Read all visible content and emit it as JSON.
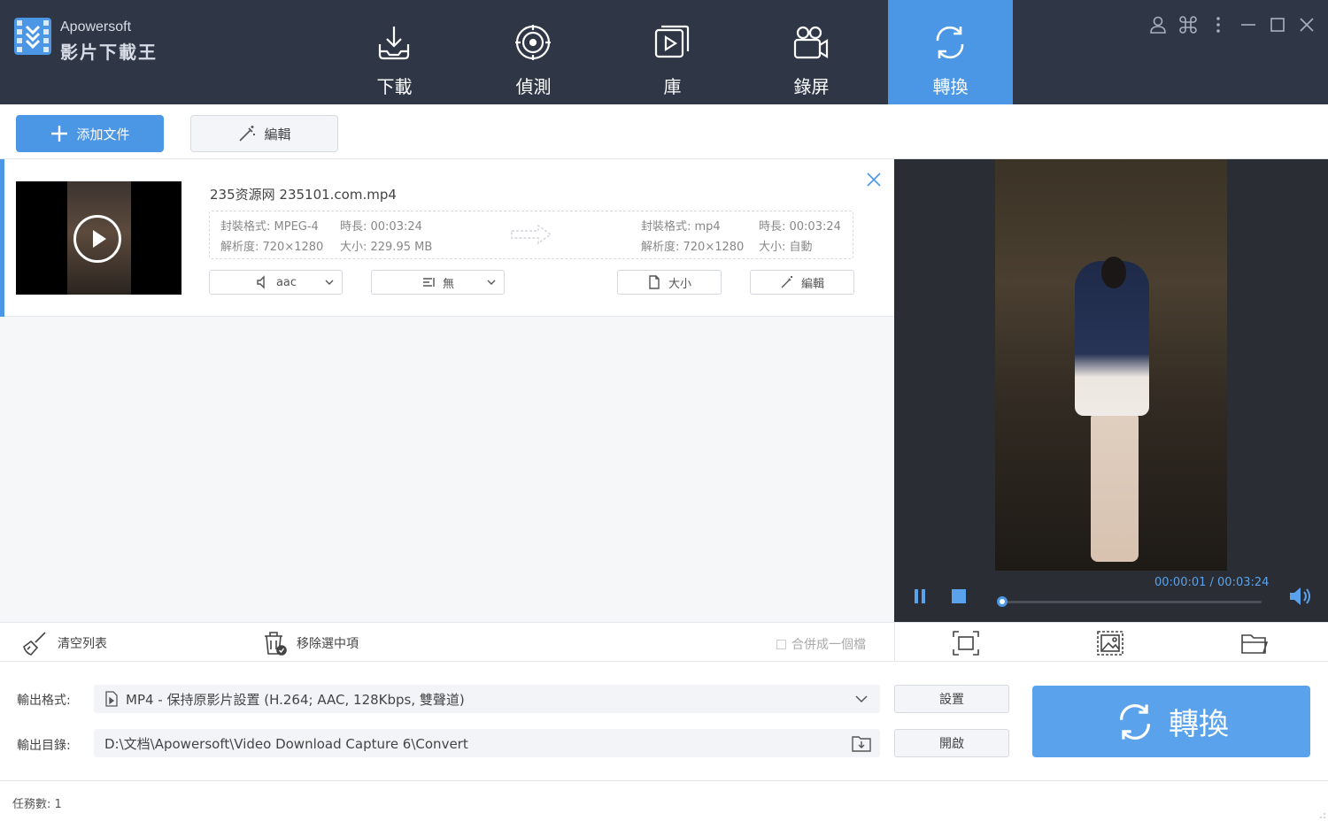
{
  "app": {
    "brand_en": "Apowersoft",
    "brand_cn": "影片下載王"
  },
  "nav": [
    {
      "label": "下載",
      "icon": "download-icon"
    },
    {
      "label": "偵測",
      "icon": "detect-icon"
    },
    {
      "label": "庫",
      "icon": "library-icon"
    },
    {
      "label": "錄屏",
      "icon": "record-icon"
    },
    {
      "label": "轉換",
      "icon": "convert-icon",
      "active": true
    }
  ],
  "toolbar": {
    "add_label": "添加文件",
    "edit_label": "編輯"
  },
  "file": {
    "name": "235资源网 235101.com.mp4",
    "src_format": "封裝格式: MPEG-4",
    "src_duration": "時長: 00:03:24",
    "src_resolution": "解析度: 720×1280",
    "src_size": "大小: 229.95 MB",
    "dst_format": "封裝格式: mp4",
    "dst_duration": "時長: 00:03:24",
    "dst_resolution": "解析度: 720×1280",
    "dst_size": "大小: 自動",
    "audio_label": "aac",
    "subtitle_label": "無",
    "size_btn": "大小",
    "edit_btn": "編輯"
  },
  "player": {
    "time": "00:00:01 / 00:03:24",
    "progress": 0.0
  },
  "list_footer": {
    "clear_label": "清空列表",
    "remove_label": "移除選中項",
    "merge_label": "合併成一個檔"
  },
  "output": {
    "format_label": "輸出格式:",
    "format_value": "MP4 - 保持原影片設置 (H.264; AAC, 128Kbps, 雙聲道)",
    "dir_label": "輸出目錄:",
    "dir_value": "D:\\文档\\Apowersoft\\Video Download Capture 6\\Convert",
    "settings_btn": "設置",
    "open_btn": "開啟",
    "convert_btn": "轉換"
  },
  "status": {
    "tasks": "任務數: 1"
  },
  "colors": {
    "accent": "#4b97e6",
    "topbar": "#2f3747"
  }
}
